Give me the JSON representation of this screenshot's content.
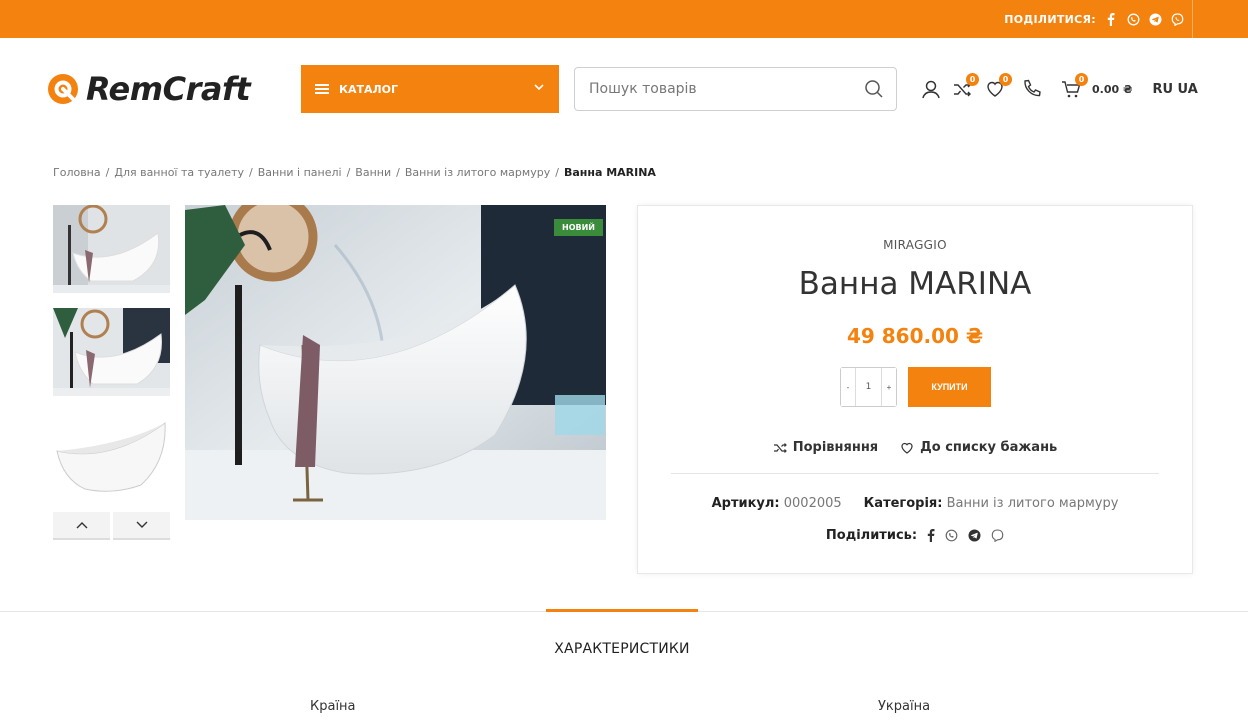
{
  "colors": {
    "accent": "#f4820f",
    "new_badge": "#3a8c3a"
  },
  "topbar": {
    "share_label": "ПОДІЛИТИСЯ:",
    "icons": [
      "facebook-icon",
      "whatsapp-icon",
      "telegram-icon",
      "viber-icon"
    ]
  },
  "header": {
    "logo": "RemCraft",
    "catalog_label": "КАТАЛОГ",
    "search_placeholder": "Пошук товарів",
    "compare_count": "0",
    "wishlist_count": "0",
    "cart_count": "0",
    "cart_total": "0.00 ₴",
    "lang_ru": "RU",
    "lang_ua": "UA"
  },
  "breadcrumbs": {
    "items": [
      "Головна",
      "Для ванної та туалету",
      "Ванни і панелі",
      "Ванни",
      "Ванни із литого мармуру"
    ],
    "separator": "/",
    "current": "Ванна MARINA"
  },
  "product": {
    "badge": "НОВИЙ",
    "brand": "MIRAGGIO",
    "title": "Ванна MARINA",
    "price": "49 860.00 ₴",
    "qty": "1",
    "qty_minus": "-",
    "qty_plus": "+",
    "buy_label": "КУПИТИ",
    "compare_label": "Порівняння",
    "wishlist_label": "До списку бажань",
    "sku_label": "Артикул:",
    "sku": "0002005",
    "category_label": "Категорія:",
    "category": "Ванни із литого мармуру",
    "share_label": "Поділитись:"
  },
  "tabs": {
    "active": "ХАРАКТЕРИСТИКИ"
  },
  "attributes": [
    {
      "name": "Країна",
      "value": "Україна"
    }
  ]
}
